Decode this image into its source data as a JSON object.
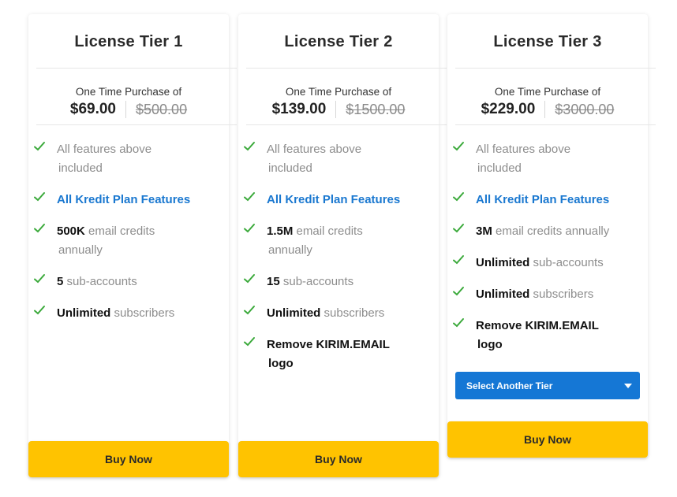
{
  "tiers": [
    {
      "title": "License Tier 1",
      "subtitle": "One Time Purchase of",
      "price": "$69.00",
      "old_price": "$500.00",
      "features": [
        {
          "line1_strong": "",
          "line1_grey": "All features above",
          "line2": "included"
        },
        {
          "blue": "All Kredit Plan Features"
        },
        {
          "strong": "500K",
          "grey": " email credits",
          "line2": "annually"
        },
        {
          "strong": "5",
          "grey": " sub-accounts"
        },
        {
          "strong": "Unlimited",
          "grey": " subscribers"
        }
      ],
      "buy_label": "Buy Now"
    },
    {
      "title": "License Tier 2",
      "subtitle": "One Time Purchase of",
      "price": "$139.00",
      "old_price": "$1500.00",
      "features": [
        {
          "line1_grey": "All features above",
          "line2": "included"
        },
        {
          "blue": "All Kredit Plan Features"
        },
        {
          "strong": "1.5M",
          "grey": " email credits",
          "line2": "annually"
        },
        {
          "strong": "15",
          "grey": " sub-accounts"
        },
        {
          "strong": "Unlimited",
          "grey": " subscribers"
        },
        {
          "strong": "Remove KIRIM.EMAIL",
          "line2_strong": "logo"
        }
      ],
      "buy_label": "Buy Now"
    },
    {
      "title": "License Tier 3",
      "subtitle": "One Time Purchase of",
      "price": "$229.00",
      "old_price": "$3000.00",
      "features": [
        {
          "line1_grey": "All features above",
          "line2": "included"
        },
        {
          "blue": "All Kredit Plan Features"
        },
        {
          "strong": "3M",
          "grey": " email credits annually"
        },
        {
          "strong": "Unlimited",
          "grey": " sub-accounts"
        },
        {
          "strong": "Unlimited",
          "grey": " subscribers"
        },
        {
          "strong": "Remove KIRIM.EMAIL",
          "line2_strong": "logo"
        }
      ],
      "select_label": "Select Another Tier",
      "buy_label": "Buy Now"
    }
  ],
  "colors": {
    "check": "#3aa93a",
    "accent_blue": "#1a78d0",
    "buy_yellow": "#ffc300"
  }
}
